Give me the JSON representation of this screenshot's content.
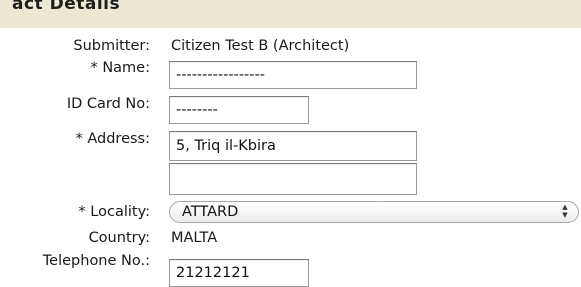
{
  "section": {
    "title": "act Details"
  },
  "form": {
    "submitter_label": "Submitter:",
    "submitter_value": "Citizen Test B (Architect)",
    "name_label": "* Name:",
    "name_value": "-----------------",
    "id_label": "ID Card No:",
    "id_value": "--------",
    "address_label": "* Address:",
    "address_line1": "5, Triq il-Kbira",
    "address_line2": "",
    "locality_label": "* Locality:",
    "locality_value": "ATTARD",
    "country_label": "Country:",
    "country_value": "MALTA",
    "telephone_label": "Telephone No.:",
    "telephone_value": "21212121"
  },
  "icons": {
    "select_arrows": "up-down-chevron-icon"
  }
}
